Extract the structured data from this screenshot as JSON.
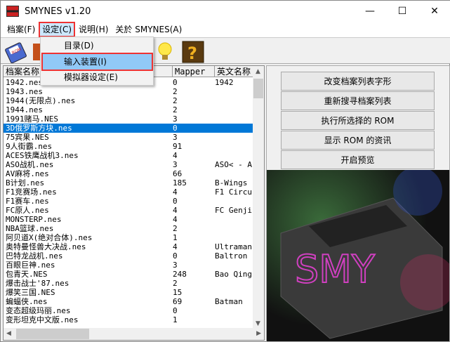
{
  "window": {
    "title": "SMYNES v1.20",
    "minimize": "—",
    "maximize": "☐",
    "close": "✕"
  },
  "menubar": [
    {
      "label": "档案(F)"
    },
    {
      "label": "设定(C)"
    },
    {
      "label": "说明(H)"
    },
    {
      "label": "关於 SMYNES(A)"
    }
  ],
  "settings_menu": [
    {
      "label": "目录(D)"
    },
    {
      "label": "输入装置(I)"
    },
    {
      "label": "模拟器设定(E)"
    }
  ],
  "toolbar": {
    "icons": [
      "rom-disk-icon",
      "book-icon",
      "lightbulb-icon",
      "help-question-icon"
    ],
    "rom_label": "ROM",
    "help_glyph": "?"
  },
  "list": {
    "columns": [
      "档案名称",
      "Mapper",
      "英文名称"
    ],
    "rows": [
      [
        "1942.nes",
        "0",
        "1942"
      ],
      [
        "1943.nes",
        "2",
        ""
      ],
      [
        "1944(无限点).nes",
        "2",
        ""
      ],
      [
        "1944.nes",
        "2",
        ""
      ],
      [
        "1991赌马.NES",
        "3",
        ""
      ],
      [
        "3D俄罗斯方块.nes",
        "0",
        ""
      ],
      [
        "75宾果.NES",
        "3",
        ""
      ],
      [
        "9人街霸.nes",
        "91",
        ""
      ],
      [
        "ACES铁鹰战机3.nes",
        "4",
        ""
      ],
      [
        "ASO战机.nes",
        "3",
        "ASO< - Ar"
      ],
      [
        "AV麻将.nes",
        "66",
        ""
      ],
      [
        "B计划.nes",
        "185",
        "B-Wings"
      ],
      [
        "F1竞赛场.nes",
        "4",
        "F1 Circus"
      ],
      [
        "F1赛车.nes",
        "0",
        ""
      ],
      [
        "FC原人.nes",
        "4",
        "FC Genjin"
      ],
      [
        "MONSTERP.nes",
        "4",
        ""
      ],
      [
        "NBA篮球.nes",
        "2",
        ""
      ],
      [
        "阿贝道X(绝对合体).nes",
        "1",
        ""
      ],
      [
        "奥特曼怪兽大决战.nes",
        "4",
        "Ultraman"
      ],
      [
        "巴特龙战机.nes",
        "0",
        "Baltron"
      ],
      [
        "百眼巨神.nes",
        "3",
        ""
      ],
      [
        "包青天.NES",
        "248",
        "Bao Qing"
      ],
      [
        "爆击战士'87.nes",
        "2",
        ""
      ],
      [
        "爆笑三国.NES",
        "15",
        ""
      ],
      [
        "蝙蝠侠.nes",
        "69",
        "Batman"
      ],
      [
        "变态超级玛丽.nes",
        "0",
        ""
      ],
      [
        "变形坦克中文版.nes",
        "1",
        ""
      ]
    ],
    "selected_index": 5
  },
  "buttons": [
    {
      "label": "改变档案列表字形"
    },
    {
      "label": "重新搜寻档案列表"
    },
    {
      "label": "执行所选择的 ROM"
    },
    {
      "label": "显示 ROM 的资讯"
    },
    {
      "label": "开启预览"
    }
  ],
  "preview": {
    "logo_text": "SMY"
  },
  "colors": {
    "selection": "#0078d7",
    "menu_highlight": "#91c9f7",
    "annotation": "#e33333"
  }
}
